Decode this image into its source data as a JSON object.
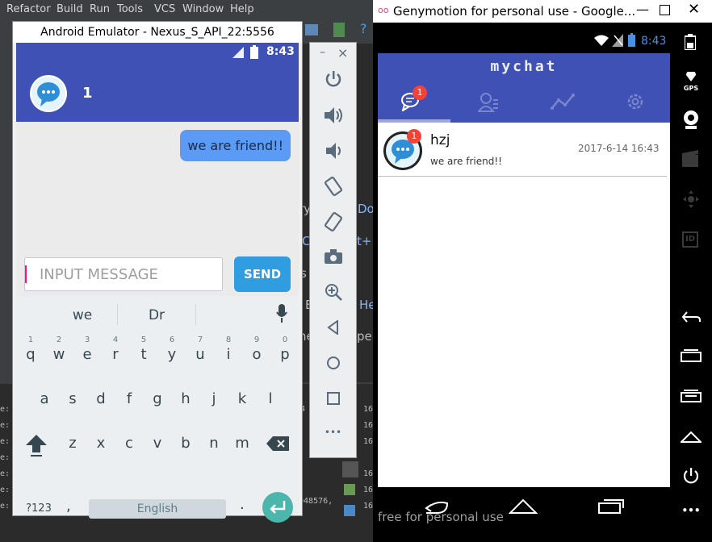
{
  "ide": {
    "menu": [
      "Refactor",
      "Build",
      "Run",
      "Tools",
      "VCS",
      "Window",
      "Help"
    ],
    "fragments": {
      "f1": "ry",
      "f2": "Do",
      "f3": "C",
      "f4": "t+",
      "f5": "s",
      "f6": "E",
      "f7": "He",
      "f8": "ne",
      "f9": "pe",
      "gutter1": "4",
      "gutter2": "048576,"
    },
    "side_numbers": [
      "16",
      "16",
      "16",
      "16",
      "16",
      "16"
    ]
  },
  "emulator": {
    "title": "Android Emulator - Nexus_S_API_22:5556",
    "status_time": "8:43",
    "chat_title": "1",
    "messages": [
      {
        "text": "we are friend!!",
        "from": "me"
      }
    ],
    "input_placeholder": "INPUT MESSAGE",
    "send_label": "SEND",
    "keyboard": {
      "suggestions": [
        "we",
        "Dr"
      ],
      "row1": [
        "q",
        "w",
        "e",
        "r",
        "t",
        "y",
        "u",
        "i",
        "o",
        "p"
      ],
      "row1_nums": [
        "1",
        "2",
        "3",
        "4",
        "5",
        "6",
        "7",
        "8",
        "9",
        "0"
      ],
      "row2": [
        "a",
        "s",
        "d",
        "f",
        "g",
        "h",
        "j",
        "k",
        "l"
      ],
      "row3": [
        "z",
        "x",
        "c",
        "v",
        "b",
        "n",
        "m"
      ],
      "symbols_key": "?123",
      "comma_key": ",",
      "space_label": "English",
      "period_key": "."
    }
  },
  "controls": {
    "minimize": "–",
    "close": "×",
    "more": "•••"
  },
  "genymotion": {
    "title": "Genymotion for personal use - Google...",
    "status_time": "8:43",
    "app_name": "mychat",
    "tab_badge": "1",
    "conversations": [
      {
        "name": "hzj",
        "preview": "we are friend!!",
        "time": "2017-6-14 16:43",
        "badge": "1"
      }
    ],
    "watermark": "free for personal use",
    "side_labels": {
      "gps": "GPS",
      "id": "ID"
    }
  },
  "colors": {
    "primary": "#3f51b5",
    "bubble": "#5b9bf5",
    "send": "#2f9de0",
    "badge": "#f44336",
    "enter": "#4db6ac"
  }
}
